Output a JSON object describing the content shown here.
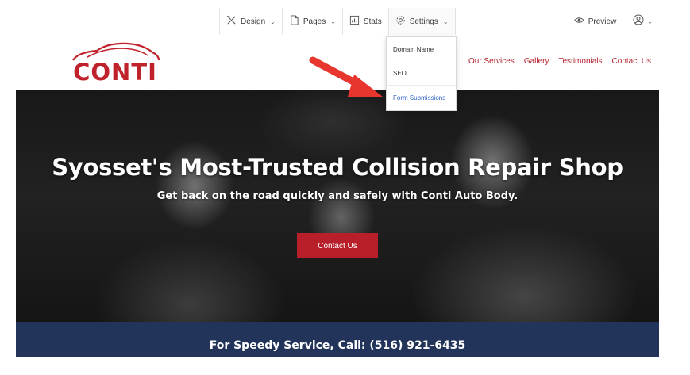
{
  "toolbar": {
    "design_label": "Design",
    "pages_label": "Pages",
    "stats_label": "Stats",
    "settings_label": "Settings",
    "preview_label": "Preview"
  },
  "settings_menu": {
    "items": [
      "Domain Name",
      "SEO",
      "Form Submissions"
    ],
    "highlight_color": "#2f63c8"
  },
  "site": {
    "logo_text": "CONTI",
    "brand_color": "#c0222b",
    "nav_partial": "s",
    "nav": [
      "Our Services",
      "Gallery",
      "Testimonials",
      "Contact Us"
    ]
  },
  "hero": {
    "title": "Syosset's Most-Trusted Collision Repair Shop",
    "subtitle": "Get back on the road quickly and safely with Conti Auto Body.",
    "cta_label": "Contact Us"
  },
  "banner": {
    "text": "For Speedy Service, Call: (516) 921-6435",
    "color": "#22345a"
  },
  "icons": [
    "design-icon",
    "pages-icon",
    "stats-icon",
    "settings-gear-icon",
    "eye-icon",
    "user-icon",
    "annotation-arrow-icon"
  ]
}
